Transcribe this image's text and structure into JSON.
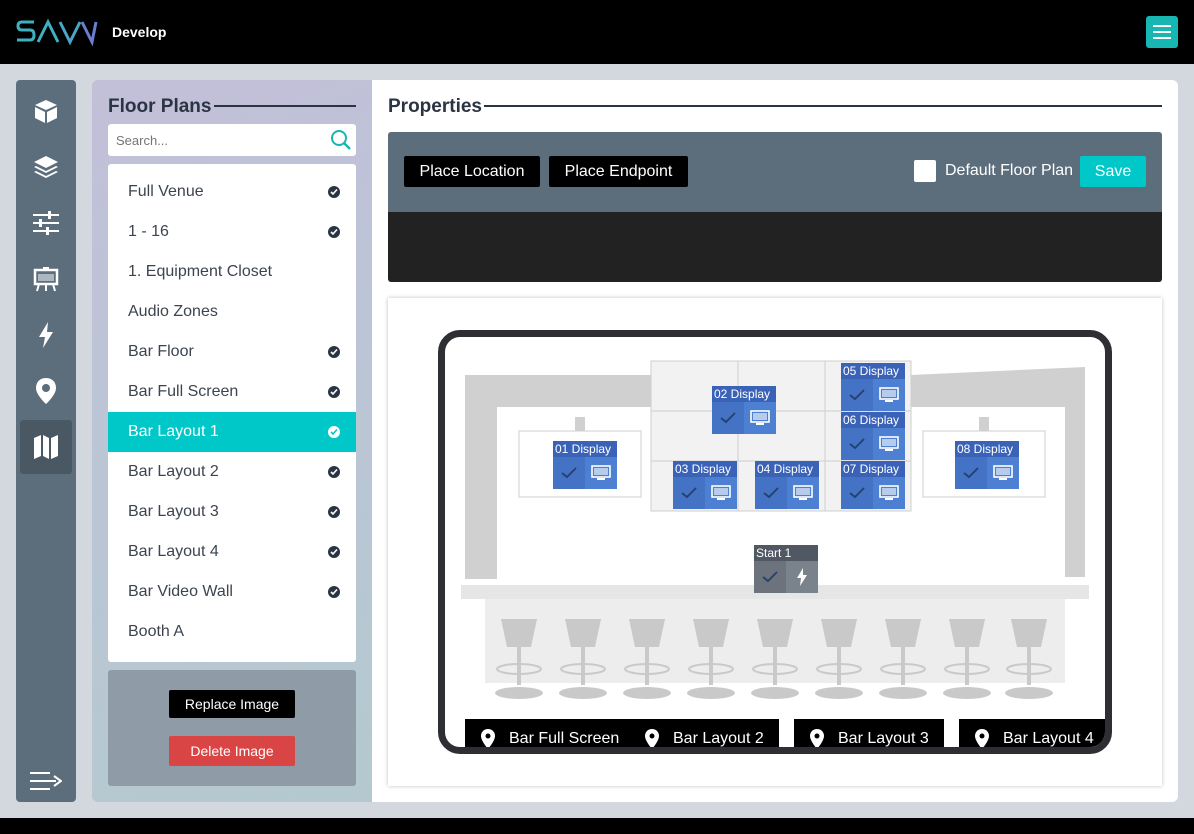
{
  "topbar": {
    "logo": "SAVI",
    "title": "Develop",
    "menu_icon": "hamburger-icon",
    "accent": "#17b6b3"
  },
  "nav": [
    {
      "icon": "cube-icon"
    },
    {
      "icon": "layers-icon"
    },
    {
      "icon": "sliders-icon"
    },
    {
      "icon": "easel-icon"
    },
    {
      "icon": "bolt-icon"
    },
    {
      "icon": "map-pin-icon"
    },
    {
      "icon": "map-icon",
      "active": true
    },
    {
      "icon": "collapse-icon"
    }
  ],
  "floor_plans": {
    "title": "Floor Plans",
    "search_placeholder": "Search...",
    "items": [
      {
        "label": "Full Venue",
        "checked": true
      },
      {
        "label": "1 - 16",
        "checked": true
      },
      {
        "label": "1. Equipment Closet",
        "checked": false
      },
      {
        "label": "Audio Zones",
        "checked": false
      },
      {
        "label": "Bar Floor",
        "checked": true
      },
      {
        "label": "Bar Full Screen",
        "checked": true
      },
      {
        "label": "Bar Layout 1",
        "checked": true,
        "active": true
      },
      {
        "label": "Bar Layout 2",
        "checked": true
      },
      {
        "label": "Bar Layout 3",
        "checked": true
      },
      {
        "label": "Bar Layout 4",
        "checked": true
      },
      {
        "label": "Bar Video Wall",
        "checked": true
      },
      {
        "label": "Booth A",
        "checked": false
      }
    ],
    "replace_label": "Replace Image",
    "delete_label": "Delete Image"
  },
  "properties": {
    "title": "Properties",
    "place_location": "Place Location",
    "place_endpoint": "Place Endpoint",
    "default_label": "Default Floor Plan",
    "default_checked": false,
    "save_label": "Save",
    "accent": "#00c8c8"
  },
  "plan": {
    "markers": [
      {
        "label": "01 Display",
        "type": "display"
      },
      {
        "label": "02 Display",
        "type": "display"
      },
      {
        "label": "03 Display",
        "type": "display"
      },
      {
        "label": "04 Display",
        "type": "display"
      },
      {
        "label": "05 Display",
        "type": "display"
      },
      {
        "label": "06 Display",
        "type": "display"
      },
      {
        "label": "07 Display",
        "type": "display"
      },
      {
        "label": "08 Display",
        "type": "display"
      },
      {
        "label": "Start 1",
        "type": "start"
      }
    ],
    "location_tags": [
      "Bar Full Screen",
      "Bar Layout 2",
      "Bar Layout 3",
      "Bar Layout 4"
    ]
  }
}
